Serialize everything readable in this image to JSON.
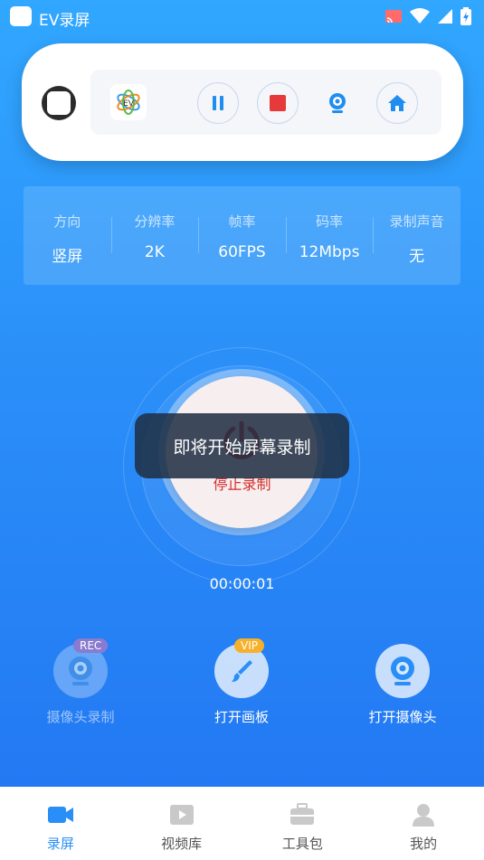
{
  "status_bar": {
    "app_title": "EV录屏"
  },
  "settings": [
    {
      "label": "方向",
      "value": "竖屏"
    },
    {
      "label": "分辨率",
      "value": "2K"
    },
    {
      "label": "帧率",
      "value": "60FPS"
    },
    {
      "label": "码率",
      "value": "12Mbps"
    },
    {
      "label": "录制声音",
      "value": "无"
    }
  ],
  "record": {
    "stop_label": "停止录制",
    "timer": "00:00:01",
    "toast": "即将开始屏幕录制"
  },
  "tools": [
    {
      "label": "摄像头录制",
      "badge": "REC",
      "enabled": false
    },
    {
      "label": "打开画板",
      "badge": "VIP",
      "enabled": true
    },
    {
      "label": "打开摄像头",
      "badge": "",
      "enabled": true
    }
  ],
  "tabs": [
    {
      "label": "录屏",
      "active": true
    },
    {
      "label": "视频库",
      "active": false
    },
    {
      "label": "工具包",
      "active": false
    },
    {
      "label": "我的",
      "active": false
    }
  ],
  "colors": {
    "accent": "#2a8ef8",
    "stop_red": "#d4302e",
    "vip": "#f7b02a"
  }
}
